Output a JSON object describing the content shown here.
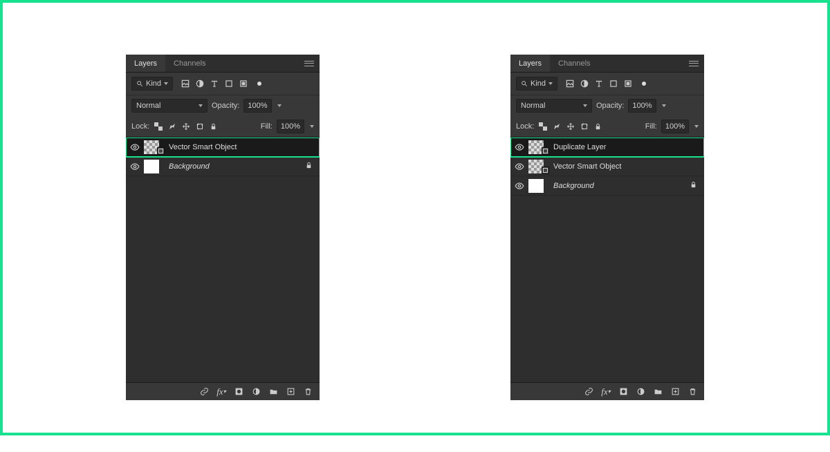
{
  "accent": "#18e28f",
  "panels": [
    {
      "tabs": {
        "active": "Layers",
        "inactive": "Channels"
      },
      "filter": {
        "label": "Kind"
      },
      "blend": {
        "mode": "Normal",
        "opacityLabel": "Opacity:",
        "opacityValue": "100%"
      },
      "lock": {
        "label": "Lock:",
        "fillLabel": "Fill:",
        "fillValue": "100%"
      },
      "layers": [
        {
          "name": "Vector Smart Object",
          "thumb": "smart",
          "selected": true,
          "highlighted": true,
          "locked": false,
          "italic": false
        },
        {
          "name": "Background",
          "thumb": "white",
          "selected": false,
          "highlighted": false,
          "locked": true,
          "italic": true
        }
      ]
    },
    {
      "tabs": {
        "active": "Layers",
        "inactive": "Channels"
      },
      "filter": {
        "label": "Kind"
      },
      "blend": {
        "mode": "Normal",
        "opacityLabel": "Opacity:",
        "opacityValue": "100%"
      },
      "lock": {
        "label": "Lock:",
        "fillLabel": "Fill:",
        "fillValue": "100%"
      },
      "layers": [
        {
          "name": "Duplicate Layer",
          "thumb": "smart",
          "selected": true,
          "highlighted": true,
          "locked": false,
          "italic": false
        },
        {
          "name": "Vector Smart Object",
          "thumb": "smart",
          "selected": false,
          "highlighted": false,
          "locked": false,
          "italic": false
        },
        {
          "name": "Background",
          "thumb": "white",
          "selected": false,
          "highlighted": false,
          "locked": true,
          "italic": true
        }
      ]
    }
  ]
}
